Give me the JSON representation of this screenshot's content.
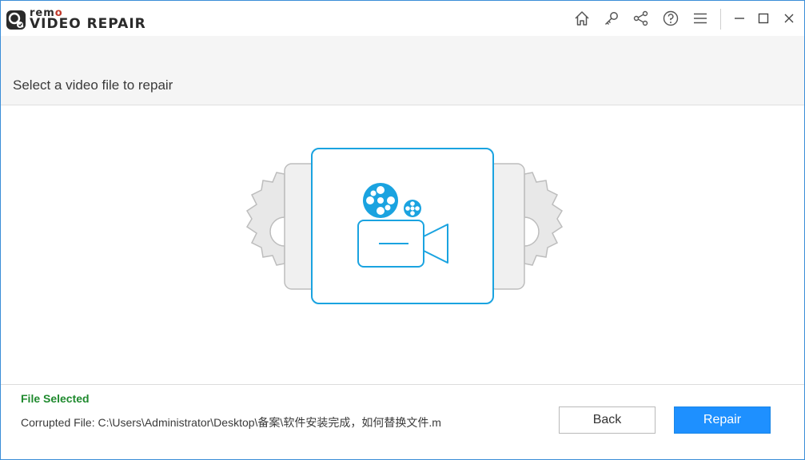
{
  "app": {
    "brand_small": "rem",
    "brand_dot": "o",
    "product_name": "VIDEO REPAIR"
  },
  "toolbar": {
    "icons": [
      "home-icon",
      "key-icon",
      "share-icon",
      "help-icon",
      "menu-icon",
      "minimize-icon",
      "maximize-icon",
      "close-icon"
    ]
  },
  "header": {
    "title": "Select a video file to repair"
  },
  "footer": {
    "status_title": "File Selected",
    "status_label": "Corrupted File:",
    "file_path": "C:\\Users\\Administrator\\Desktop\\备案\\软件安装完成，如何替换文件.m",
    "back_label": "Back",
    "repair_label": "Repair"
  },
  "colors": {
    "accent": "#1e90ff",
    "illustration_blue": "#1aa3e0",
    "status_green": "#1f8a2e"
  }
}
